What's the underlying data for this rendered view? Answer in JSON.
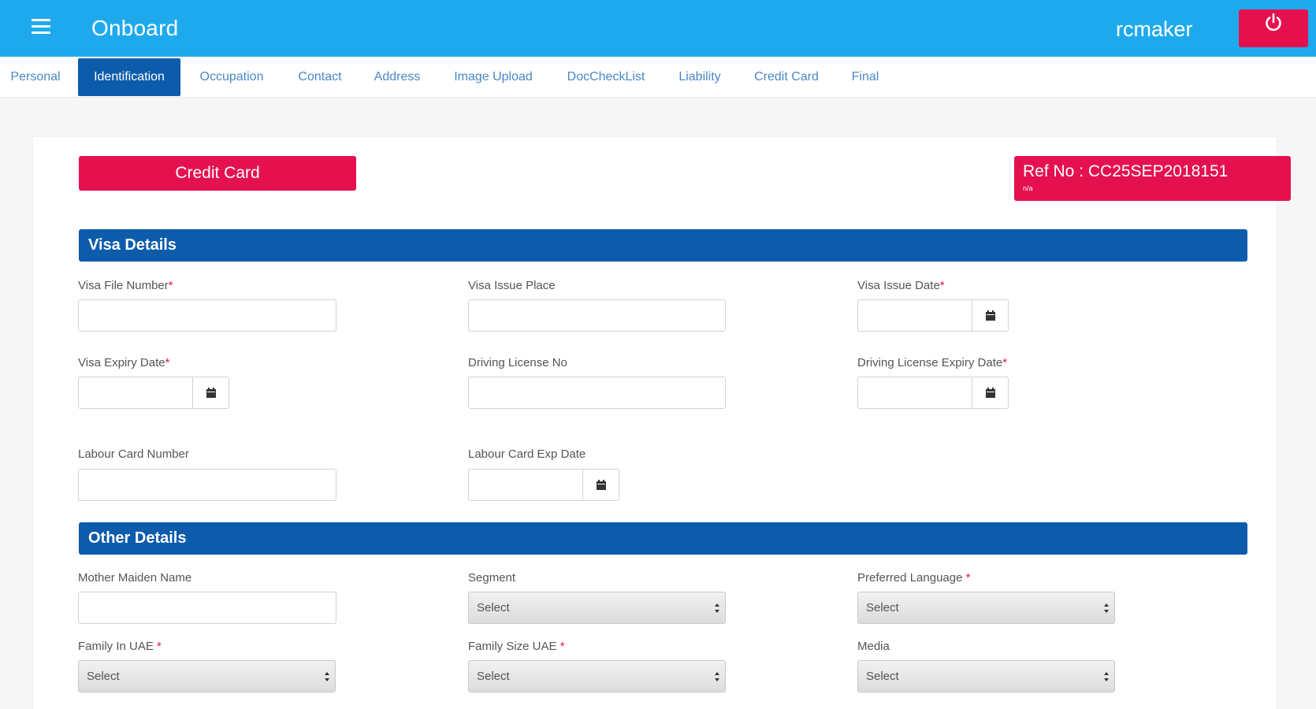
{
  "header": {
    "title": "Onboard",
    "username": "rcmaker"
  },
  "tabs": [
    {
      "label": "Personal"
    },
    {
      "label": "Identification"
    },
    {
      "label": "Occupation"
    },
    {
      "label": "Contact"
    },
    {
      "label": "Address"
    },
    {
      "label": "Image Upload"
    },
    {
      "label": "DocCheckList"
    },
    {
      "label": "Liability"
    },
    {
      "label": "Credit Card"
    },
    {
      "label": "Final"
    }
  ],
  "active_tab": "Identification",
  "product_button": "Credit Card",
  "reference": {
    "label": "Ref No : CC25SEP2018151",
    "sub": "n/a"
  },
  "visa_section": {
    "title": "Visa Details",
    "visa_file_number_label": "Visa File Number",
    "visa_issue_place_label": "Visa Issue Place",
    "visa_issue_date_label": "Visa Issue Date",
    "visa_expiry_date_label": "Visa Expiry Date",
    "driving_license_no_label": "Driving License No",
    "driving_license_expiry_label": "Driving License Expiry Date",
    "labour_card_number_label": "Labour Card Number",
    "labour_card_exp_date_label": "Labour Card Exp Date"
  },
  "other_section": {
    "title": "Other Details",
    "mother_maiden_name_label": "Mother Maiden Name",
    "segment_label": "Segment",
    "preferred_language_label": "Preferred Language",
    "family_in_uae_label": "Family In UAE",
    "family_size_uae_label": "Family Size UAE",
    "media_label": "Media",
    "segment_value": "Select",
    "preferred_language_value": "Select",
    "family_in_uae_value": "Select",
    "family_size_uae_value": "Select",
    "media_value": "Select"
  },
  "required_marker": "*",
  "colors": {
    "topbar": "#1fa9ed",
    "accent_red": "#e5114f",
    "section_blue": "#0d5bab",
    "tab_link": "#4a88c7"
  },
  "icons": {
    "menu": "hamburger-icon",
    "power": "power-icon",
    "calendar": "calendar-icon"
  }
}
